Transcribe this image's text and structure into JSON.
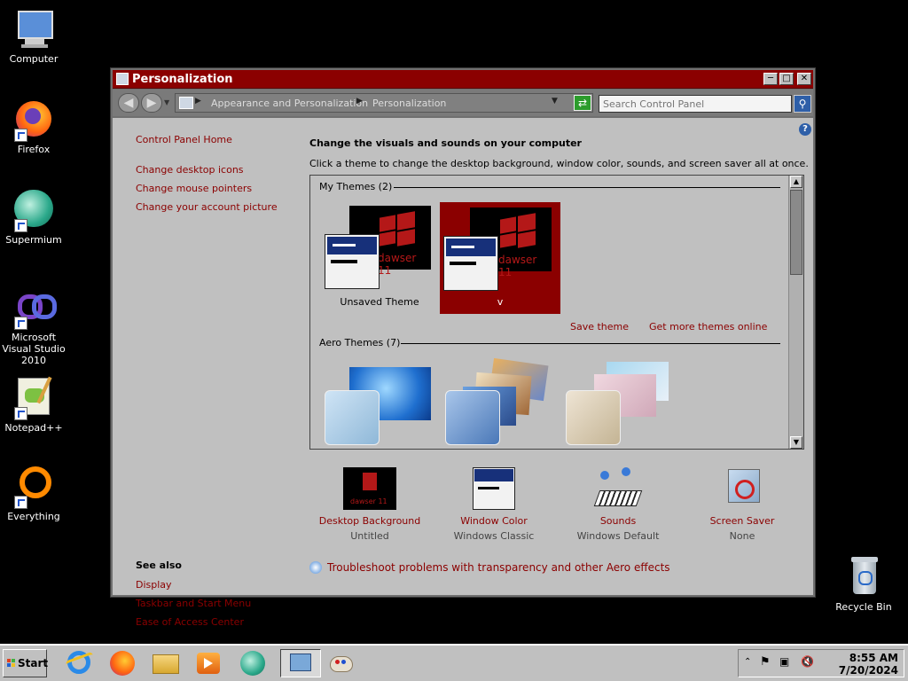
{
  "desktop": {
    "icons": [
      {
        "label": "Computer"
      },
      {
        "label": "Firefox"
      },
      {
        "label": "Supermium"
      },
      {
        "label": "Microsoft Visual Studio 2010"
      },
      {
        "label": "Notepad++"
      },
      {
        "label": "Everything"
      },
      {
        "label": "Recycle Bin"
      }
    ]
  },
  "window": {
    "title": "Personalization",
    "breadcrumb": [
      "Appearance and Personalization",
      "Personalization"
    ],
    "search_placeholder": "Search Control Panel",
    "sidebar": {
      "links": [
        "Control Panel Home",
        "Change desktop icons",
        "Change mouse pointers",
        "Change your account picture"
      ],
      "see_also_title": "See also",
      "see_also": [
        "Display",
        "Taskbar and Start Menu",
        "Ease of Access Center"
      ]
    },
    "heading": "Change the visuals and sounds on your computer",
    "subtext": "Click a theme to change the desktop background, window color, sounds, and screen saver all at once.",
    "my_themes_label": "My Themes (2)",
    "my_themes": [
      {
        "name": "Unsaved Theme",
        "wallpaper_text": "dawser 11"
      },
      {
        "name": "v",
        "wallpaper_text": "dawser 11"
      }
    ],
    "save_theme": "Save theme",
    "get_more_themes": "Get more themes online",
    "aero_themes_label": "Aero Themes (7)",
    "bottom": [
      {
        "name": "Desktop Background",
        "value": "Untitled",
        "thumb_text": "dawser 11"
      },
      {
        "name": "Window Color",
        "value": "Windows Classic"
      },
      {
        "name": "Sounds",
        "value": "Windows Default"
      },
      {
        "name": "Screen Saver",
        "value": "None"
      }
    ],
    "troubleshoot": "Troubleshoot problems with transparency and other Aero effects"
  },
  "taskbar": {
    "start_label": "Start",
    "time": "8:55 AM",
    "date": "7/20/2024"
  },
  "colors": {
    "accent": "#8b0000",
    "window_bg": "#c0c0c0",
    "desktop_bg": "#000000"
  }
}
